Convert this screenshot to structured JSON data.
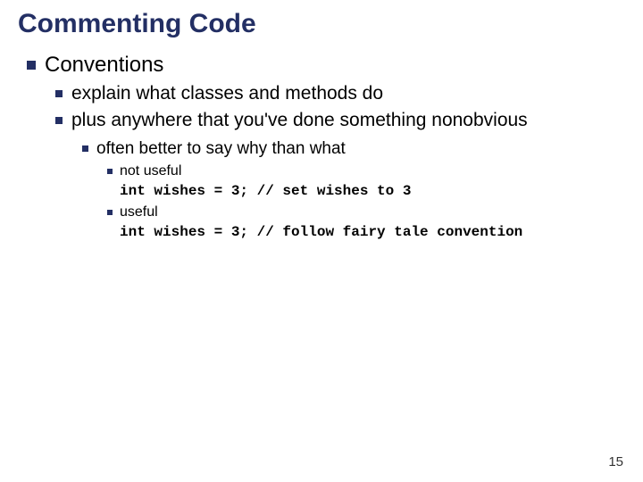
{
  "title": "Commenting Code",
  "l1": "Conventions",
  "l2a": "explain what classes and methods do",
  "l2b": "plus anywhere that you've done something nonobvious",
  "l3": "often better to say why than what",
  "l4a": "not useful",
  "code_a": "int wishes = 3; // set wishes to 3",
  "l4b": "useful",
  "code_b": "int wishes = 3; // follow fairy tale convention",
  "page_number": "15"
}
